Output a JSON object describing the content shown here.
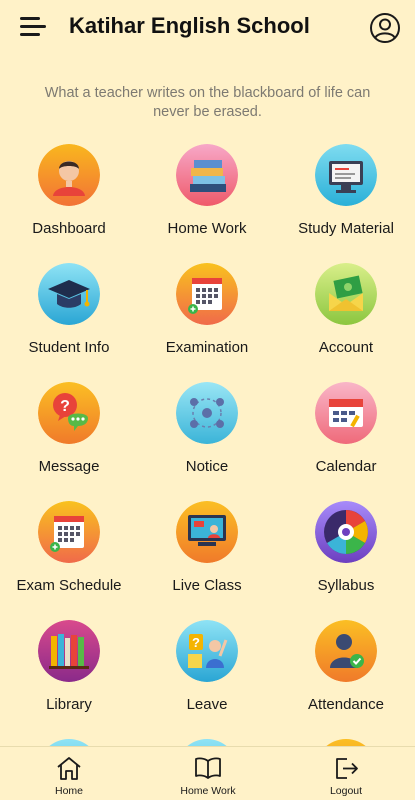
{
  "header": {
    "title": "Katihar English School",
    "menu_icon": "hamburger-menu-icon",
    "profile_icon": "user-circle-icon"
  },
  "quote": "What a teacher writes on the blackboard of life can never be erased.",
  "menu_items": [
    {
      "label": "Dashboard",
      "icon": "student-avatar-icon"
    },
    {
      "label": "Home Work",
      "icon": "books-stack-icon"
    },
    {
      "label": "Study Material",
      "icon": "computer-monitor-icon"
    },
    {
      "label": "Student Info",
      "icon": "graduation-cap-icon"
    },
    {
      "label": "Examination",
      "icon": "calendar-add-icon"
    },
    {
      "label": "Account",
      "icon": "money-envelope-icon"
    },
    {
      "label": "Message",
      "icon": "chat-bubbles-icon"
    },
    {
      "label": "Notice",
      "icon": "network-people-icon"
    },
    {
      "label": "Calendar",
      "icon": "calendar-page-icon"
    },
    {
      "label": "Exam Schedule",
      "icon": "calendar-add-icon"
    },
    {
      "label": "Live Class",
      "icon": "video-class-icon"
    },
    {
      "label": "Syllabus",
      "icon": "syllabus-wheel-icon"
    },
    {
      "label": "Library",
      "icon": "bookshelf-icon"
    },
    {
      "label": "Leave",
      "icon": "question-person-icon"
    },
    {
      "label": "Attendance",
      "icon": "person-check-icon"
    }
  ],
  "bottom_nav": [
    {
      "label": "Home",
      "icon": "home-icon"
    },
    {
      "label": "Home Work",
      "icon": "open-book-icon"
    },
    {
      "label": "Logout",
      "icon": "logout-icon"
    }
  ],
  "colors": {
    "background": "#fff2c8",
    "icon_gradient_orange": "#f7a21b",
    "icon_gradient_pink": "#ef5a7a",
    "icon_gradient_cyan": "#4cc9e8"
  }
}
